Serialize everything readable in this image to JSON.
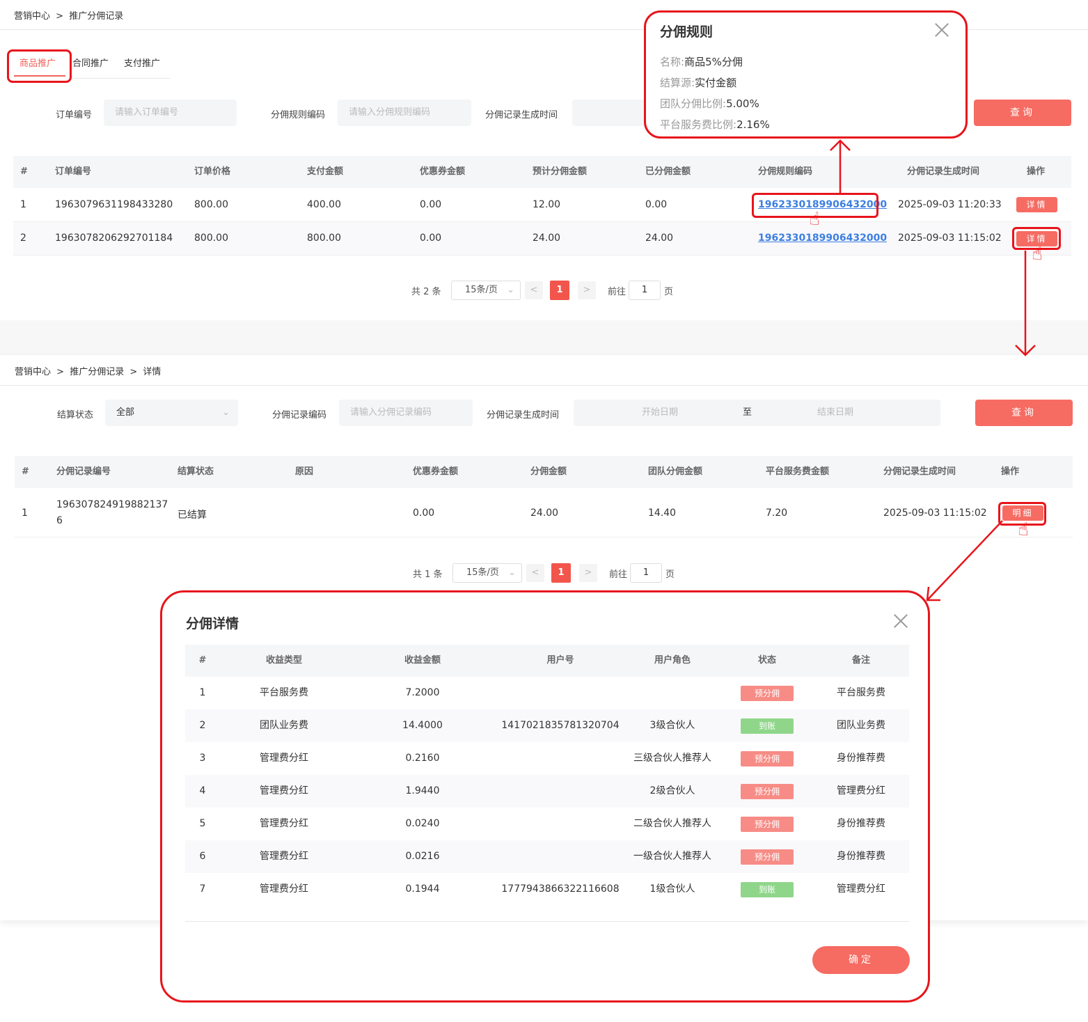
{
  "top": {
    "breadcrumb": [
      "营销中心",
      ">",
      "推广分佣记录"
    ],
    "tabs": [
      "商品推广",
      "合同推广",
      "支付推广"
    ],
    "filters": {
      "order_no_label": "订单编号",
      "order_no_placeholder": "请输入订单编号",
      "rule_code_label": "分佣规则编码",
      "rule_code_placeholder": "请输入分佣规则编码",
      "time_label": "分佣记录生成时间",
      "query_label": "查询"
    },
    "columns": [
      "#",
      "订单编号",
      "订单价格",
      "支付金额",
      "优惠券金额",
      "预计分佣金额",
      "已分佣金额",
      "分佣规则编码",
      "分佣记录生成时间",
      "操作"
    ],
    "rows": [
      {
        "idx": "1",
        "order_no": "1963079631198433280",
        "price": "800.00",
        "paid": "400.00",
        "coupon": "0.00",
        "expected": "12.00",
        "done": "0.00",
        "rule": "1962330189906432000",
        "time": "2025-09-03 11:20:33",
        "action": "详情"
      },
      {
        "idx": "2",
        "order_no": "1963078206292701184",
        "price": "800.00",
        "paid": "800.00",
        "coupon": "0.00",
        "expected": "24.00",
        "done": "24.00",
        "rule": "1962330189906432000",
        "time": "2025-09-03 11:15:02",
        "action": "详情"
      }
    ],
    "pager": {
      "total": "共 2 条",
      "size": "15条/页",
      "prev": "<",
      "current": "1",
      "next": ">",
      "goto": "前往",
      "page_input": "1",
      "page_suffix": "页"
    }
  },
  "rule_popover": {
    "title": "分佣规则",
    "name_label": "名称:",
    "name": "商品5%分佣",
    "source_label": "结算源:",
    "source": "实付金额",
    "team_label": "团队分佣比例:",
    "team": "5.00%",
    "platform_label": "平台服务费比例:",
    "platform": "2.16%"
  },
  "detail": {
    "breadcrumb": [
      "营销中心",
      ">",
      "推广分佣记录",
      ">",
      "详情"
    ],
    "filters": {
      "status_label": "结算状态",
      "status_value": "全部",
      "record_label": "分佣记录编码",
      "record_placeholder": "请输入分佣记录编码",
      "time_label": "分佣记录生成时间",
      "start_placeholder": "开始日期",
      "to": "至",
      "end_placeholder": "结束日期",
      "query_label": "查询"
    },
    "columns": [
      "#",
      "分佣记录编号",
      "结算状态",
      "原因",
      "优惠券金额",
      "分佣金额",
      "团队分佣金额",
      "平台服务费金额",
      "分佣记录生成时间",
      "操作"
    ],
    "rows": [
      {
        "idx": "1",
        "record_no_1": "196307824919882137",
        "record_no_2": "6",
        "status": "已结算",
        "reason": "",
        "coupon": "0.00",
        "amount": "24.00",
        "team": "14.40",
        "platform": "7.20",
        "time": "2025-09-03 11:15:02",
        "action": "明细"
      }
    ],
    "pager": {
      "total": "共 1 条",
      "size": "15条/页",
      "prev": "<",
      "current": "1",
      "next": ">",
      "goto": "前往",
      "page_input": "1",
      "page_suffix": "页"
    }
  },
  "modal": {
    "title": "分佣详情",
    "columns": [
      "#",
      "收益类型",
      "收益金额",
      "用户号",
      "用户角色",
      "状态",
      "备注"
    ],
    "rows": [
      {
        "idx": "1",
        "type": "平台服务费",
        "amount": "7.2000",
        "user": "",
        "role": "",
        "status": "预分佣",
        "status_kind": "pre",
        "note": "平台服务费"
      },
      {
        "idx": "2",
        "type": "团队业务费",
        "amount": "14.4000",
        "user": "1417021835781320704",
        "role": "3级合伙人",
        "status": "到账",
        "status_kind": "done",
        "note": "团队业务费"
      },
      {
        "idx": "3",
        "type": "管理费分红",
        "amount": "0.2160",
        "user": "",
        "role": "三级合伙人推荐人",
        "status": "预分佣",
        "status_kind": "pre",
        "note": "身份推荐费"
      },
      {
        "idx": "4",
        "type": "管理费分红",
        "amount": "1.9440",
        "user": "",
        "role": "2级合伙人",
        "status": "预分佣",
        "status_kind": "pre",
        "note": "管理费分红"
      },
      {
        "idx": "5",
        "type": "管理费分红",
        "amount": "0.0240",
        "user": "",
        "role": "二级合伙人推荐人",
        "status": "预分佣",
        "status_kind": "pre",
        "note": "身份推荐费"
      },
      {
        "idx": "6",
        "type": "管理费分红",
        "amount": "0.0216",
        "user": "",
        "role": "一级合伙人推荐人",
        "status": "预分佣",
        "status_kind": "pre",
        "note": "身份推荐费"
      },
      {
        "idx": "7",
        "type": "管理费分红",
        "amount": "0.1944",
        "user": "1777943866322116608",
        "role": "1级合伙人",
        "status": "到账",
        "status_kind": "done",
        "note": "管理费分红"
      }
    ],
    "ok_label": "确定"
  },
  "colors": {
    "accent": "#f66b62",
    "highlight": "#e8141b",
    "link": "#3d7fe0",
    "pre_badge": "#f78c86",
    "done_badge": "#8fd68a"
  }
}
